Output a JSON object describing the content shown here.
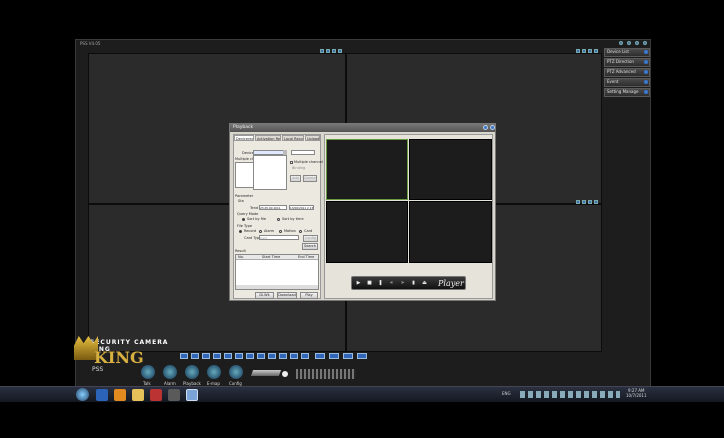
{
  "app": {
    "title": "PSS V4.05"
  },
  "sidebar": {
    "items": [
      {
        "label": "Device List"
      },
      {
        "label": "PTZ Direction"
      },
      {
        "label": "PTZ Advanced"
      },
      {
        "label": "Event"
      },
      {
        "label": "Setting Manage"
      }
    ]
  },
  "dialog": {
    "title": "Playback",
    "tabs": [
      "Devicerecord",
      "Activation Record",
      "Local Record",
      "Upload"
    ],
    "device_label": "Device",
    "multiple_label": "Multiple chann",
    "multiple_channel_checkbox": "Multiple channel",
    "binding_label": "Binding",
    "add_button": "Add",
    "delete_button": "Delete",
    "parameter_label": "Parameter",
    "start_label": "Sta",
    "end_label": "Tend",
    "start_time": "23:45:00 2011",
    "end_time": "13/06/2011 2 23:59:00 PM",
    "query_mode_label": "Query Mode",
    "sort_by_file": "Sort by file",
    "sort_by_time": "Sort by time",
    "file_type_label": "File Type",
    "file_types": [
      "Record",
      "Alarm",
      "Motion",
      "Card"
    ],
    "card_type_label": "Card Type",
    "card_type_value": "Card",
    "config_button": "Config",
    "search_button": "Search",
    "result_label": "Result",
    "result_columns": [
      "No.",
      "Start Time",
      "End Time"
    ],
    "bottom_buttons": [
      "Dl.Wk",
      "Download",
      "Play"
    ],
    "player_brand": "Player"
  },
  "logo": {
    "text": "SECURITY CAMERA KING",
    "sub": "PSS"
  },
  "toolbar": {
    "labels": [
      "Talk",
      "Alarm",
      "Playback",
      "E-map",
      "Config"
    ]
  },
  "taskbar": {
    "lang": "ENG",
    "time": "9:27 AM",
    "date": "10/7/2011"
  }
}
